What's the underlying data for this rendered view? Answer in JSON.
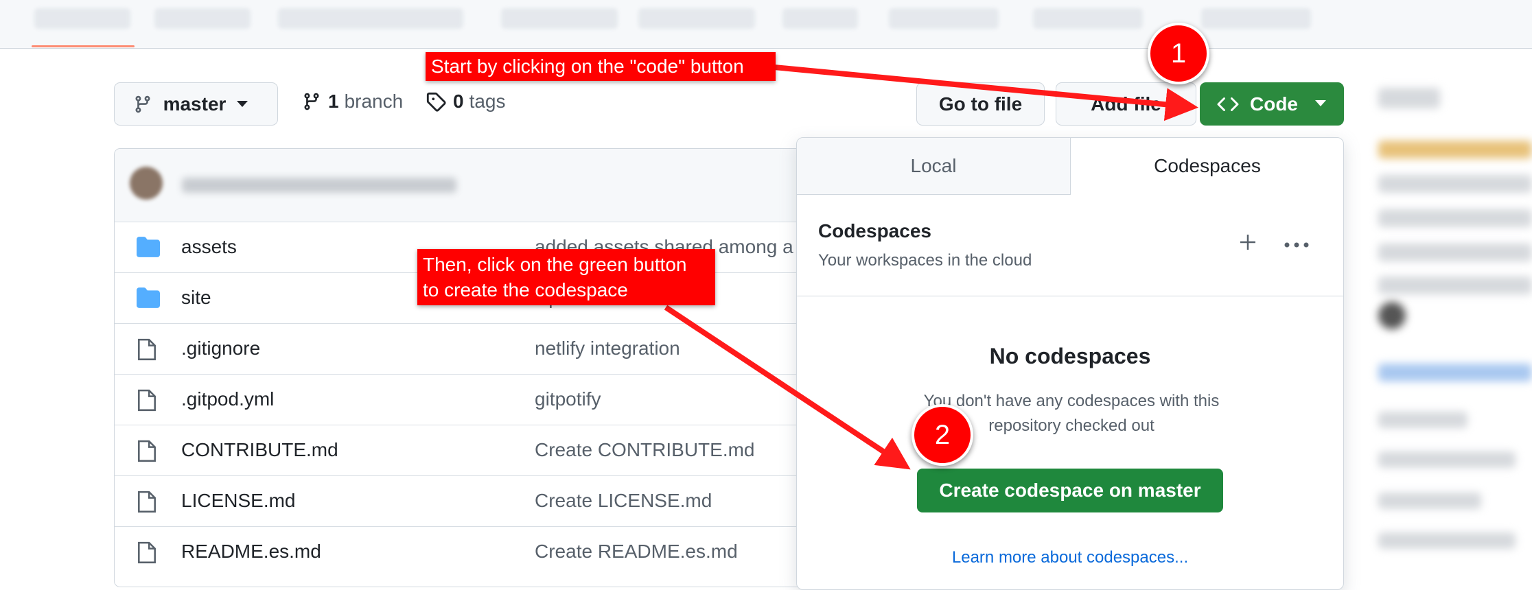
{
  "repo": {
    "branch_name": "master",
    "branch_count": "1",
    "branch_word": "branch",
    "tag_count": "0",
    "tag_word": "tags",
    "goto_file": "Go to file",
    "add_file": "Add file",
    "code_label": "Code"
  },
  "files": [
    {
      "name": "assets",
      "type": "folder",
      "message": "added assets shared among a"
    },
    {
      "name": "site",
      "type": "folder",
      "message": "Update index.html"
    },
    {
      "name": ".gitignore",
      "type": "file",
      "message": "netlify integration"
    },
    {
      "name": ".gitpod.yml",
      "type": "file",
      "message": "gitpotify"
    },
    {
      "name": "CONTRIBUTE.md",
      "type": "file",
      "message": "Create CONTRIBUTE.md"
    },
    {
      "name": "LICENSE.md",
      "type": "file",
      "message": "Create LICENSE.md"
    },
    {
      "name": "README.es.md",
      "type": "file",
      "message": "Create README.es.md"
    }
  ],
  "popup": {
    "tab_local": "Local",
    "tab_codespaces": "Codespaces",
    "section_title": "Codespaces",
    "section_subtitle": "Your workspaces in the cloud",
    "empty_title": "No codespaces",
    "empty_description": "You don't have any codespaces with this repository checked out",
    "create_button": "Create codespace on master",
    "learn_more": "Learn more about codespaces..."
  },
  "annotations": {
    "step1_text": "Start by clicking on the \"code\" button",
    "step2_line1": "Then, click on the green button",
    "step2_line2": "to create the codespace",
    "badge1": "1",
    "badge2": "2"
  },
  "colors": {
    "code_button": "#2b8a3e",
    "create_button": "#1f883d",
    "annotation_red": "#ff0000",
    "link_blue": "#0969da",
    "folder_blue": "#54aeff"
  }
}
